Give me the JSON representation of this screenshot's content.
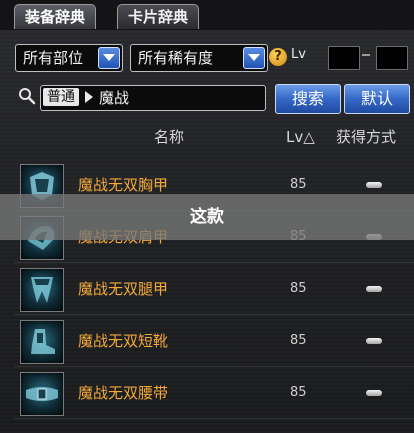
{
  "tabs": [
    {
      "label": "装备辞典"
    },
    {
      "label": "卡片辞典"
    }
  ],
  "filters": {
    "slot_select": "所有部位",
    "rarity_select": "所有稀有度",
    "level_label": "Lv",
    "level_min": "",
    "level_max": ""
  },
  "search": {
    "category_chip": "普通",
    "query": "魔战",
    "search_button": "搜索",
    "default_button": "默认"
  },
  "table": {
    "col_name": "名称",
    "col_level": "Lv△",
    "col_acquire": "获得方式",
    "rows": [
      {
        "name": "魔战无双胸甲",
        "level": "85"
      },
      {
        "name": "魔战无双肩甲",
        "level": "85"
      },
      {
        "name": "魔战无双腿甲",
        "level": "85"
      },
      {
        "name": "魔战无双短靴",
        "level": "85"
      },
      {
        "name": "魔战无双腰带",
        "level": "85"
      }
    ]
  },
  "overlay": {
    "caption": "这款"
  },
  "colors": {
    "item_name": "#f3a93a",
    "button_blue": "#3568c6",
    "overlay_gray": "#787878"
  }
}
